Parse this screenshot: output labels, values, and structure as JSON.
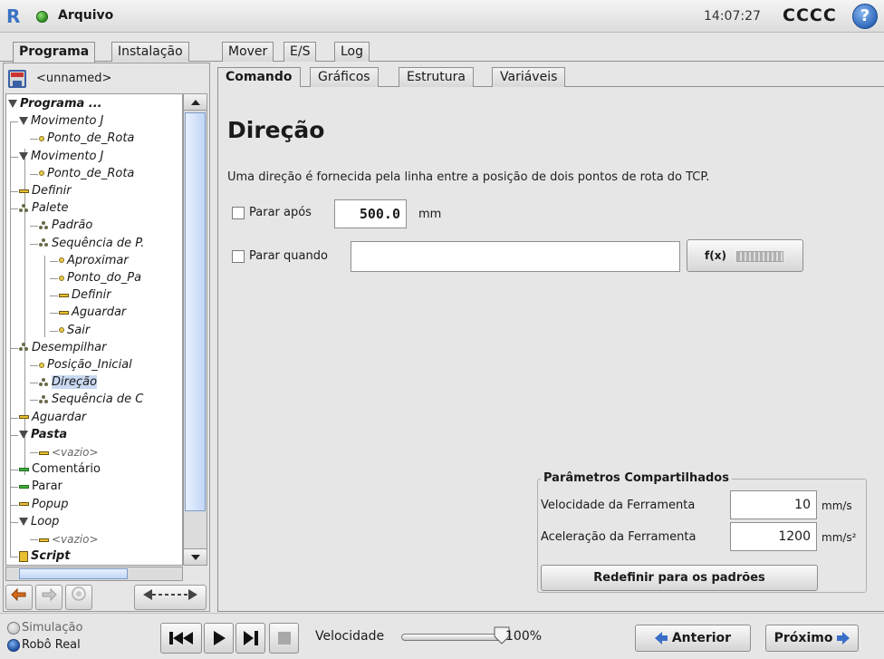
{
  "header": {
    "menu_title": "Arquivo",
    "clock": "14:07:27",
    "robot_name": "CCCC",
    "help_glyph": "?",
    "logo_text": "R"
  },
  "main_tabs": [
    {
      "label": "Programa",
      "active": true
    },
    {
      "label": "Instalação",
      "active": false
    },
    {
      "label": "Mover",
      "active": false
    },
    {
      "label": "E/S",
      "active": false
    },
    {
      "label": "Log",
      "active": false
    }
  ],
  "program": {
    "file_name": "<unnamed>"
  },
  "tree": [
    {
      "label": "Programa ...",
      "style": "bold",
      "icon": "triangle-icon"
    },
    {
      "label": "Movimento J",
      "style": "it",
      "icon": "triangle-icon"
    },
    {
      "label": "Ponto_de_Rota",
      "style": "it",
      "icon": "waypoint-icon"
    },
    {
      "label": "Movimento J",
      "style": "it",
      "icon": "triangle-icon"
    },
    {
      "label": "Ponto_de_Rota",
      "style": "it",
      "icon": "waypoint-icon"
    },
    {
      "label": "Definir",
      "style": "it",
      "icon": "bar-icon"
    },
    {
      "label": "Palete",
      "style": "it",
      "icon": "pallet-icon"
    },
    {
      "label": "Padrão",
      "style": "it",
      "icon": "pallet-icon"
    },
    {
      "label": "Sequência de P.",
      "style": "it",
      "icon": "pallet-icon"
    },
    {
      "label": "Aproximar",
      "style": "it",
      "icon": "waypoint-icon"
    },
    {
      "label": "Ponto_do_Pa",
      "style": "it",
      "icon": "waypoint-icon"
    },
    {
      "label": "Definir",
      "style": "it",
      "icon": "bar-icon"
    },
    {
      "label": "Aguardar",
      "style": "it",
      "icon": "bar-icon"
    },
    {
      "label": "Sair",
      "style": "it",
      "icon": "waypoint-icon"
    },
    {
      "label": "Desempilhar",
      "style": "it",
      "icon": "pallet-icon"
    },
    {
      "label": "Posição_Inicial",
      "style": "it",
      "icon": "waypoint-icon"
    },
    {
      "label": "Direção",
      "style": "it",
      "icon": "pallet-icon",
      "selected": true
    },
    {
      "label": "Sequência de C",
      "style": "it",
      "icon": "pallet-icon"
    },
    {
      "label": "Aguardar",
      "style": "it",
      "icon": "bar-icon"
    },
    {
      "label": "Pasta",
      "style": "bold",
      "icon": "triangle-icon"
    },
    {
      "label": "<vazio>",
      "style": "gray",
      "icon": "bar-icon"
    },
    {
      "label": "Comentário",
      "style": "plain",
      "icon": "bar-green-icon"
    },
    {
      "label": "Parar",
      "style": "plain",
      "icon": "bar-green-icon"
    },
    {
      "label": "Popup",
      "style": "it",
      "icon": "bar-icon"
    },
    {
      "label": "Loop",
      "style": "it",
      "icon": "triangle-icon"
    },
    {
      "label": "<vazio>",
      "style": "gray",
      "icon": "bar-icon"
    },
    {
      "label": "Script",
      "style": "bold",
      "icon": "script-icon"
    }
  ],
  "sub_tabs": [
    {
      "label": "Comando",
      "active": true
    },
    {
      "label": "Gráficos",
      "active": false
    },
    {
      "label": "Estrutura",
      "active": false
    },
    {
      "label": "Variáveis",
      "active": false
    }
  ],
  "command": {
    "title": "Direção",
    "description": "Uma direção é fornecida pela linha entre a posição de dois pontos de rota do TCP.",
    "stop_after_label": "Parar após",
    "stop_after_value": "500.0",
    "stop_after_unit": "mm",
    "stop_after_checked": false,
    "stop_when_label": "Parar quando",
    "stop_when_value": "",
    "stop_when_checked": false,
    "fx_label": "f(x)"
  },
  "shared_params": {
    "title": "Parâmetros Compartilhados",
    "tool_speed_label": "Velocidade da Ferramenta",
    "tool_speed_value": "10",
    "tool_speed_unit": "mm/s",
    "tool_accel_label": "Aceleração da Ferramenta",
    "tool_accel_value": "1200",
    "tool_accel_unit": "mm/s²",
    "reset_label": "Redefinir para os padrões"
  },
  "footer": {
    "simulation_label": "Simulação",
    "real_robot_label": "Robô Real",
    "real_robot_selected": true,
    "speed_label": "Velocidade",
    "speed_value": "100%",
    "speed_fraction": 1.0,
    "prev_label": "Anterior",
    "next_label": "Próximo"
  },
  "colors": {
    "accent_blue": "#3a6fc8",
    "selection": "#c9d9f2",
    "status_green": "#2b8a1e"
  }
}
